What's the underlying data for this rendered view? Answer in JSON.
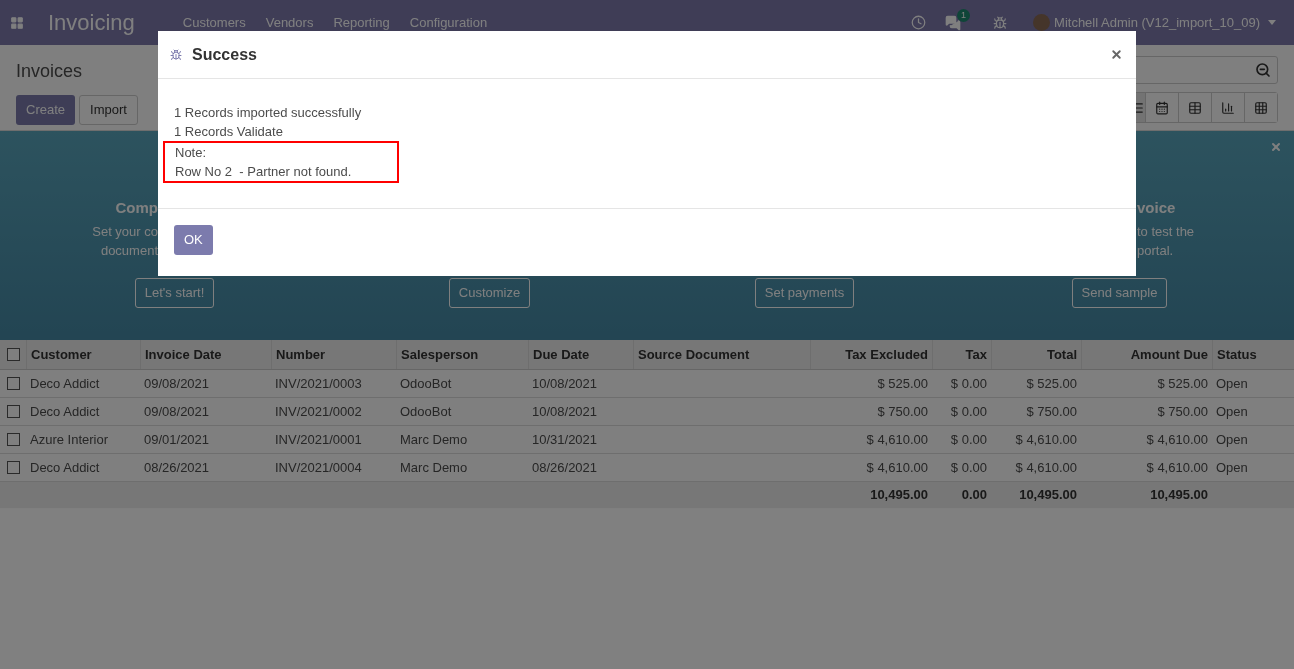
{
  "navbar": {
    "app_title": "Invoicing",
    "menu": [
      "Customers",
      "Vendors",
      "Reporting",
      "Configuration"
    ],
    "message_count": "1",
    "user": "Mitchell Admin (V12_import_10_09)"
  },
  "control_panel": {
    "title": "Invoices",
    "buttons": [
      {
        "label": "Create",
        "kind": "primary"
      },
      {
        "label": "Import",
        "kind": "secondary"
      }
    ],
    "views": [
      {
        "kind": "list",
        "selected": true
      },
      {
        "kind": "calendar",
        "selected": false
      },
      {
        "kind": "pivot",
        "selected": false
      },
      {
        "kind": "graph",
        "selected": false
      },
      {
        "kind": "grid",
        "selected": false
      }
    ]
  },
  "banner": {
    "steps": [
      {
        "kind": "cut_end",
        "title": "Comp",
        "lines": [
          "Set your co",
          "document"
        ],
        "button": "Let's start!"
      },
      {
        "kind": "hidden",
        "button": "Customize"
      },
      {
        "kind": "hidden",
        "button": "Set payments"
      },
      {
        "kind": "cut_start",
        "title": "voice",
        "lines": [
          "to test the",
          "portal."
        ],
        "button": "Send sample"
      }
    ]
  },
  "table": {
    "select_all": {
      "checked": false
    },
    "columns": [
      {
        "label": "Customer",
        "kind": "text"
      },
      {
        "label": "Invoice Date",
        "kind": "text"
      },
      {
        "label": "Number",
        "kind": "text"
      },
      {
        "label": "Salesperson",
        "kind": "text"
      },
      {
        "label": "Due Date",
        "kind": "text"
      },
      {
        "label": "Source Document",
        "kind": "text"
      },
      {
        "label": "Tax Excluded",
        "kind": "money"
      },
      {
        "label": "Tax",
        "kind": "money"
      },
      {
        "label": "Total",
        "kind": "money"
      },
      {
        "label": "Amount Due",
        "kind": "money"
      },
      {
        "label": "Status",
        "kind": "text"
      }
    ],
    "rows": [
      {
        "checked": false,
        "cells": [
          "Deco Addict",
          "09/08/2021",
          "INV/2021/0003",
          "OdooBot",
          "10/08/2021",
          null,
          "$ 525.00",
          "$ 0.00",
          "$ 525.00",
          "$ 525.00",
          "Open"
        ]
      },
      {
        "checked": false,
        "cells": [
          "Deco Addict",
          "09/08/2021",
          "INV/2021/0002",
          "OdooBot",
          "10/08/2021",
          null,
          "$ 750.00",
          "$ 0.00",
          "$ 750.00",
          "$ 750.00",
          "Open"
        ]
      },
      {
        "checked": false,
        "cells": [
          "Azure Interior",
          "09/01/2021",
          "INV/2021/0001",
          "Marc Demo",
          "10/31/2021",
          null,
          "$ 4,610.00",
          "$ 0.00",
          "$ 4,610.00",
          "$ 4,610.00",
          "Open"
        ]
      },
      {
        "checked": false,
        "cells": [
          "Deco Addict",
          "08/26/2021",
          "INV/2021/0004",
          "Marc Demo",
          "08/26/2021",
          null,
          "$ 4,610.00",
          "$ 0.00",
          "$ 4,610.00",
          "$ 4,610.00",
          "Open"
        ]
      }
    ],
    "totals": [
      "10,495.00",
      "0.00",
      "10,495.00",
      "10,495.00"
    ]
  },
  "dialog": {
    "title": "Success",
    "lines": [
      "1 Records imported successfully",
      "1 Records Validate"
    ],
    "note": {
      "highlighted": true,
      "lines": [
        "Note:",
        "Row No 2  - Partner not found."
      ]
    },
    "ok_button": "OK"
  }
}
